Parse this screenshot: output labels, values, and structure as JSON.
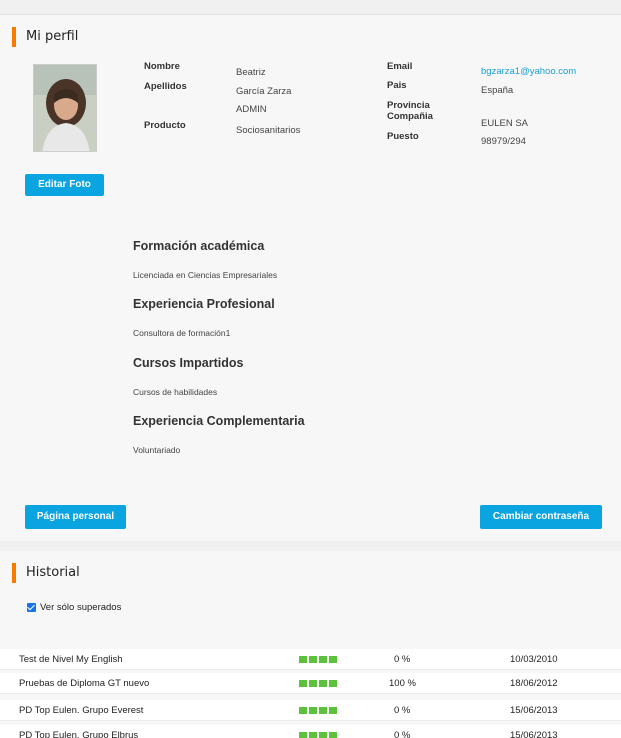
{
  "profile": {
    "title": "Mi perfil",
    "edit_photo_label": "Editar Foto",
    "fields_left": [
      {
        "label": "Nombre",
        "value": "Beatriz"
      },
      {
        "label": "Apellidos",
        "value": "García Zarza"
      },
      {
        "label": "",
        "value": "ADMIN"
      },
      {
        "label": "Producto",
        "value": "Sociosanitarios"
      }
    ],
    "fields_right": [
      {
        "label": "Email",
        "value": "bgzarza1@yahoo.com"
      },
      {
        "label": "Pais",
        "value": "España"
      },
      {
        "label": "Provincia",
        "value": ""
      },
      {
        "label": "Compañia",
        "value": "EULEN SA"
      },
      {
        "label": "Puesto",
        "value": "98979/294"
      }
    ],
    "sections": [
      {
        "heading": "Formación académica",
        "text": "Licenciada en Ciencias Empresariales"
      },
      {
        "heading": "Experiencia Profesional",
        "text": "Consultora de formación1"
      },
      {
        "heading": "Cursos Impartidos",
        "text": "Cursos de habilidades"
      },
      {
        "heading": "Experiencia Complementaria",
        "text": "Voluntariado"
      }
    ],
    "personal_page_label": "Página personal",
    "change_password_label": "Cambiar contraseña"
  },
  "history": {
    "title": "Historial",
    "filter_label": "Ver sólo superados",
    "filter_checked": true,
    "rows": [
      {
        "name": "Test de Nivel My English",
        "percent": "0 %",
        "date": "10/03/2010"
      },
      {
        "name": "Pruebas de Diploma GT nuevo",
        "percent": "100 %",
        "date": "18/06/2012"
      },
      {
        "name": "PD Top Eulen. Grupo Everest",
        "percent": "0 %",
        "date": "15/06/2013"
      },
      {
        "name": "PD Top Eulen. Grupo Elbrus",
        "percent": "0 %",
        "date": "15/06/2013"
      }
    ],
    "progress_color": "#5cc13b"
  },
  "colors": {
    "accent": "#f57c00",
    "button": "#0aa4e0",
    "link": "#1a9fd8"
  }
}
